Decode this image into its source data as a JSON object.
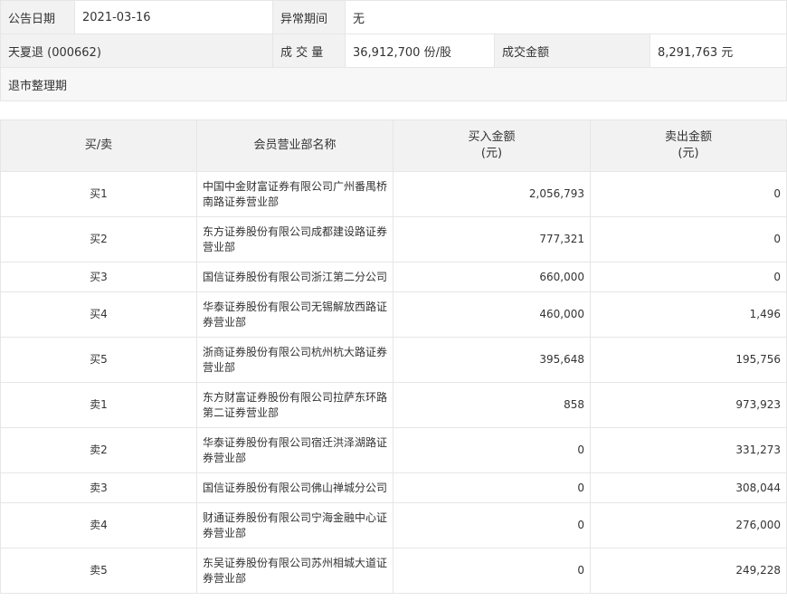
{
  "info": {
    "announce_date_label": "公告日期",
    "announce_date": "2021-03-16",
    "abnormal_period_label": "异常期间",
    "abnormal_period": "无",
    "stock_name": "天夏退 (000662)",
    "volume_label": "成 交 量",
    "volume": "36,912,700 份/股",
    "amount_label": "成交金额",
    "amount": "8,291,763 元",
    "reason": "退市整理期"
  },
  "table": {
    "headers": {
      "side": "买/卖",
      "branch": "会员营业部名称",
      "buy_line1": "买入金额",
      "buy_line2": "(元)",
      "sell_line1": "卖出金额",
      "sell_line2": "(元)"
    },
    "rows": [
      {
        "side": "买1",
        "branch": "中国中金财富证券有限公司广州番禺桥南路证券营业部",
        "buy": "2,056,793",
        "sell": "0"
      },
      {
        "side": "买2",
        "branch": "东方证券股份有限公司成都建设路证券营业部",
        "buy": "777,321",
        "sell": "0"
      },
      {
        "side": "买3",
        "branch": "国信证券股份有限公司浙江第二分公司",
        "buy": "660,000",
        "sell": "0"
      },
      {
        "side": "买4",
        "branch": "华泰证券股份有限公司无锡解放西路证券营业部",
        "buy": "460,000",
        "sell": "1,496"
      },
      {
        "side": "买5",
        "branch": "浙商证券股份有限公司杭州杭大路证券营业部",
        "buy": "395,648",
        "sell": "195,756"
      },
      {
        "side": "卖1",
        "branch": "东方财富证券股份有限公司拉萨东环路第二证券营业部",
        "buy": "858",
        "sell": "973,923"
      },
      {
        "side": "卖2",
        "branch": "华泰证券股份有限公司宿迁洪泽湖路证券营业部",
        "buy": "0",
        "sell": "331,273"
      },
      {
        "side": "卖3",
        "branch": "国信证券股份有限公司佛山禅城分公司",
        "buy": "0",
        "sell": "308,044"
      },
      {
        "side": "卖4",
        "branch": "财通证券股份有限公司宁海金融中心证券营业部",
        "buy": "0",
        "sell": "276,000"
      },
      {
        "side": "卖5",
        "branch": "东吴证券股份有限公司苏州相城大道证券营业部",
        "buy": "0",
        "sell": "249,228"
      }
    ]
  }
}
